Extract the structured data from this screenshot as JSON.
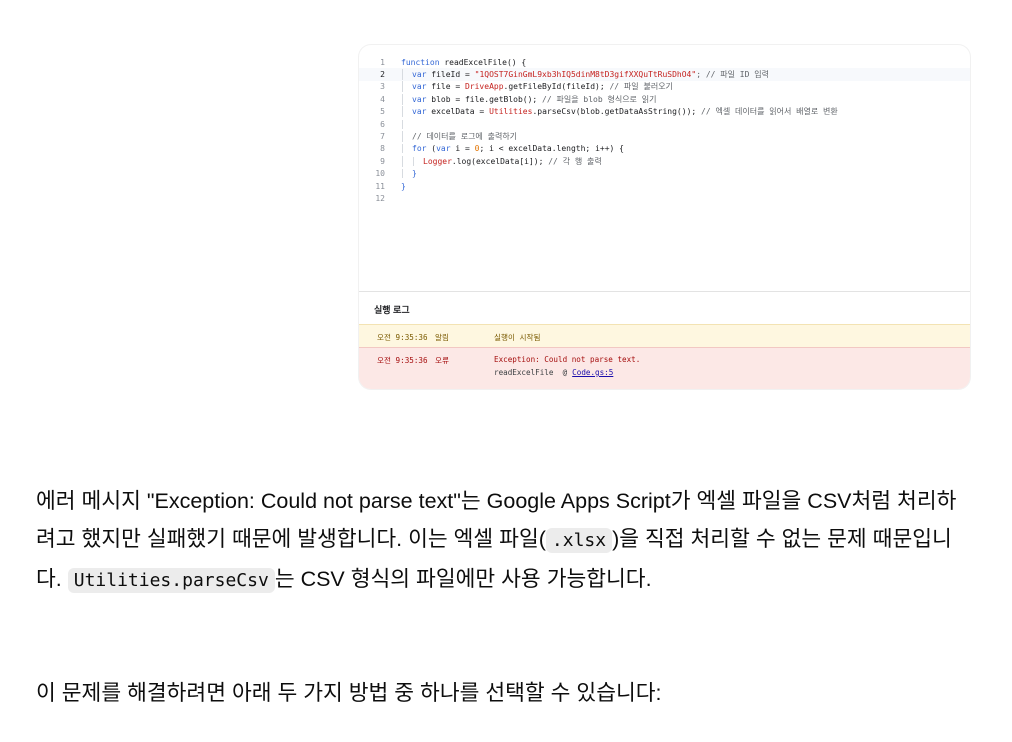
{
  "code_lines": [
    {
      "n": "1",
      "t": ""
    },
    {
      "n": "2",
      "t": ""
    },
    {
      "n": "3",
      "t": ""
    },
    {
      "n": "4",
      "t": ""
    },
    {
      "n": "5",
      "t": ""
    },
    {
      "n": "6",
      "t": ""
    },
    {
      "n": "7",
      "t": ""
    },
    {
      "n": "8",
      "t": ""
    },
    {
      "n": "9",
      "t": ""
    },
    {
      "n": "10",
      "t": ""
    },
    {
      "n": "11",
      "t": ""
    },
    {
      "n": "12",
      "t": ""
    }
  ],
  "code": {
    "l1_kw": "function",
    "l1_rest": " readExcelFile() {",
    "l2_kw": "var",
    "l2_a": " fileId = ",
    "l2_str": "\"1QOST7GinGmL9xb3hIQ5dinM8tD3gifXXQuTtRuSDhO4\"",
    "l2_cmt": "; // 파일 ID 입력",
    "l3_kw": "var",
    "l3_a": " file = ",
    "l3_fn": "DriveApp",
    "l3_b": ".getFileById(fileId); ",
    "l3_cmt": "// 파일 불러오기",
    "l4_kw": "var",
    "l4_a": " blob = file.getBlob(); ",
    "l4_cmt": "// 파일을 blob 형식으로 읽기",
    "l5_kw": "var",
    "l5_a": " excelData = ",
    "l5_fn": "Utilities",
    "l5_b": ".parseCsv(blob.getDataAsString()); ",
    "l5_cmt": "// 엑셀 데이터를 읽어서 배열로 변환",
    "l7_cmt": "// 데이터를 로그에 출력하기",
    "l8_kw": "for",
    "l8_a": " (",
    "l8_kw2": "var",
    "l8_b": " i = ",
    "l8_num": "0",
    "l8_c": "; i < excelData.length; i++) {",
    "l9_fn": "Logger",
    "l9_a": ".log(excelData[i]); ",
    "l9_cmt": "// 각 행 출력",
    "l10": "}",
    "l11": "}"
  },
  "log": {
    "title": "실행 로그",
    "rows": [
      {
        "time": "오전 9:35:36",
        "level": "알림",
        "message": "실행이 시작됨"
      },
      {
        "time": "오전 9:35:36",
        "level": "오류",
        "message": "Exception: Could not parse text."
      }
    ],
    "trace_fn": "readExcelFile",
    "trace_at": "@",
    "trace_link": "Code.gs:5"
  },
  "paragraph1": {
    "a": "에러 메시지 \"Exception: Could not parse text\"는 Google Apps Script가 엑셀 파일을 CSV처럼 처리하려고 했지만 실패했기 때문에 발생합니다. 이는 엑셀 파일(",
    "code1": ".xlsx",
    "b": ")을 직접 처리할 수 없는 문제 때문입니다. ",
    "code2": "Utilities.parseCsv",
    "c": "는 CSV 형식의 파일에만 사용 가능합니다."
  },
  "paragraph2": "이 문제를 해결하려면 아래 두 가지 방법 중 하나를 선택할 수 있습니다:"
}
